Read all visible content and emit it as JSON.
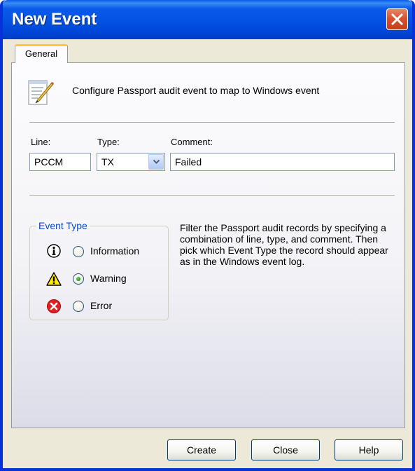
{
  "window": {
    "title": "New Event"
  },
  "tabs": [
    {
      "label": "General",
      "selected": true
    }
  ],
  "header": {
    "text": "Configure Passport audit event to map to Windows event"
  },
  "fields": {
    "line": {
      "label": "Line:",
      "value": "PCCM"
    },
    "type": {
      "label": "Type:",
      "value": "TX"
    },
    "comment": {
      "label": "Comment:",
      "value": "Failed"
    }
  },
  "event_type": {
    "title": "Event Type",
    "options": [
      {
        "label": "Information",
        "icon": "information-icon",
        "selected": false
      },
      {
        "label": "Warning",
        "icon": "warning-icon",
        "selected": true
      },
      {
        "label": "Error",
        "icon": "error-icon",
        "selected": false
      }
    ]
  },
  "description": "Filter the Passport audit records by specifying a combination of line, type, and comment.  Then pick which Event Type the record should appear as in the Windows event log.",
  "buttons": {
    "create": "Create",
    "close": "Close",
    "help": "Help"
  },
  "colors": {
    "titlebar": "#0a5ae8",
    "group_title": "#0046d5",
    "face": "#ece9d8"
  }
}
